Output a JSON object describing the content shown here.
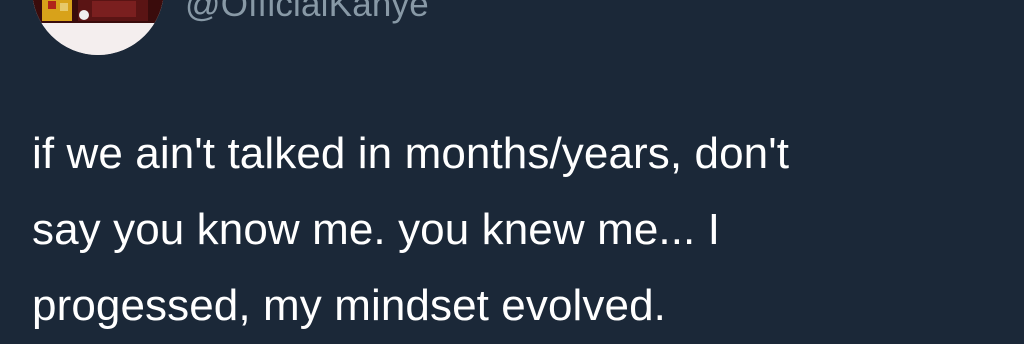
{
  "tweet": {
    "author_handle": "@OfficialKanye",
    "avatar_icon": "profile-avatar-icon",
    "text_lines": [
      "if we ain't talked in months/years, don't",
      "say you know me. you knew me... I",
      "progessed, my mindset evolved."
    ]
  },
  "colors": {
    "background": "#1b2838",
    "text": "#ffffff",
    "handle": "#8899a6"
  }
}
